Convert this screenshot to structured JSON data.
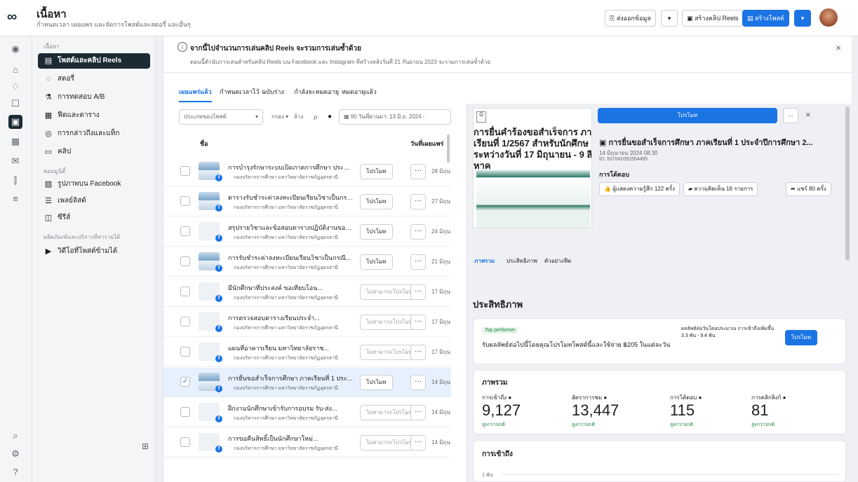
{
  "header": {
    "title": "เนื้อหา",
    "subtitle": "กำหนดเวลา เผยแพร่ และจัดการโพสต์และสตอรี่ และอื่นๆ",
    "buttons": {
      "export": "ส่งออกข้อมูล",
      "create_reel": "สร้างคลิป Reels",
      "create_post": "สร้างโพสต์"
    }
  },
  "nav": {
    "section_content": "เนื้อหา",
    "items": [
      {
        "label": "โพสต์และคลิป Reels",
        "icon": "posts-icon"
      },
      {
        "label": "สตอรี่",
        "icon": "story-icon"
      },
      {
        "label": "การทดสอบ A/B",
        "icon": "ab-test-icon"
      },
      {
        "label": "ฟีดและตาราง",
        "icon": "feed-grid-icon"
      },
      {
        "label": "การกล่าวถึงและแท็ก",
        "icon": "mention-icon"
      },
      {
        "label": "คลิป",
        "icon": "clip-icon"
      }
    ],
    "section_community": "คอมมูนิตี้",
    "items2": [
      {
        "label": "รูปภาพบน Facebook",
        "icon": "image-icon"
      },
      {
        "label": "เพลย์ลิสต์",
        "icon": "playlist-icon"
      },
      {
        "label": "ซีรีส์",
        "icon": "series-icon"
      }
    ],
    "section_monetize": "ผลิตภัณฑ์และบริการที่หารายได้",
    "items3": [
      {
        "label": "วิดีโอที่โพสต์ข้ามได้",
        "icon": "video-icon"
      }
    ]
  },
  "banner": {
    "title": "จากนี้ไปจำนวนการเล่นคลิป Reels จะรวมการเล่นซ้ำด้วย",
    "body": "ตอนนี้ตัวนับการเล่นสำหรับคลิป Reels บน Facebook และ Instagram ที่สร้างหลังวันที่ 21 กันยายน 2023 จะรวมการเล่นซ้ำด้วย"
  },
  "tabs": [
    "เผยแพร่แล้ว",
    "กำหนดเวลาไว้",
    "ฉบับร่าง",
    "กำลังจะหมดอายุ",
    "หมดอายุแล้ว"
  ],
  "filters": {
    "type": "ประเภทของโพสต์",
    "more": "กรอง",
    "clear": "ล้าง",
    "date_range": "90 วันที่ผ่านมา: 13 มิ.ย. 2024 -"
  },
  "columns": {
    "title": "ชื่อ",
    "date": "วันที่เผยแพร่"
  },
  "rows": [
    {
      "title": "การบำรุงรักษาระบบเปิดภาคการศึกษา ประจำภาคเรียน...",
      "sub": "กองบริหารการศึกษา มหาวิทยาลัยราชภัฏอุดรธานี",
      "boost": "โปรโมท",
      "date": "28 มิถุนายน",
      "thumb": true,
      "selected": false
    },
    {
      "title": "ตารางรับชำระค่าลงทะเบียนเรียนวิชาเป็นกรณี...",
      "sub": "กองบริหารการศึกษา มหาวิทยาลัยราชภัฏอุดรธานี",
      "boost": "โปรโมท",
      "date": "27 มิถุนายน",
      "thumb": true,
      "selected": false
    },
    {
      "title": "สรุปรายวิชาและข้อสอบตารางปฏิบัติงานของแต่ละ...",
      "sub": "กองบริหารการศึกษา มหาวิทยาลัยราชภัฏอุดรธานี",
      "boost": "โปรโมท",
      "date": "24 มิถุนายน",
      "thumb": false,
      "selected": false
    },
    {
      "title": "การรับชำระค่าลงทะเบียนเรียนวิชาเป็นกรณี...",
      "sub": "กองบริหารการศึกษา มหาวิทยาลัยราชภัฏอุดรธานี",
      "boost": "โปรโมท",
      "date": "21 มิถุนายน",
      "thumb": true,
      "selected": false
    },
    {
      "title": "มีนักศึกษาที่ประสงค์ ขอเทียบโอน...",
      "sub": "กองบริหารการศึกษา มหาวิทยาลัยราชภัฏอุดรธานี",
      "boost": "ไม่สามารถโปรโมทได้",
      "date": "17 มิถุนายน",
      "thumb": false,
      "selected": false
    },
    {
      "title": "การตรวจสอบตารางเรียนประจำ...",
      "sub": "กองบริหารการศึกษา มหาวิทยาลัยราชภัฏอุดรธานี",
      "boost": "ไม่สามารถโปรโมทได้",
      "date": "17 มิถุนายน",
      "thumb": false,
      "selected": false
    },
    {
      "title": "แผนที่อาคารเรียน มหาวิทยาลัยราช...",
      "sub": "กองบริหารการศึกษา มหาวิทยาลัยราชภัฏอุดรธานี",
      "boost": "ไม่สามารถโปรโมทได้",
      "date": "17 มิถุนายน",
      "thumb": false,
      "selected": false
    },
    {
      "title": "การยื่นขอสำเร็จการศึกษา ภาคเรียนที่ 1 ประ...",
      "sub": "กองบริหารการศึกษา มหาวิทยาลัยราชภัฏอุดรธานี",
      "boost": "โปรโมท",
      "date": "14 มิถุนายน",
      "thumb": true,
      "selected": true
    },
    {
      "title": "ฝึกงานนักศึกษาเข้ารับการอบรม รับ-ส่ง...",
      "sub": "กองบริหารการศึกษา มหาวิทยาลัยราชภัฏอุดรธานี",
      "boost": "ไม่สามารถโปรโมทได้",
      "date": "14 มิถุนายน",
      "thumb": false,
      "selected": false
    },
    {
      "title": "การขอคืนสิทธิ์เป็นนักศึกษาใหม่...",
      "sub": "กองบริหารการศึกษา มหาวิทยาลัยราชภัฏอุดรธานี",
      "boost": "ไม่สามารถโปรโมทได้",
      "date": "14 มิถุนายน",
      "thumb": false,
      "selected": false
    }
  ],
  "detail": {
    "preview_title": "การยื่นคำร้องขอสำเร็จการ ภาคเรียนที่ 1/2567 สำหรับนักศึกษ ระหว่างวันที่ 17 มิถุนายน - 9 สิงหาค",
    "boost_label": "โปรโมท",
    "post_title": "การยื่นขอสำเร็จการศึกษา ภาคเรียนที่ 1 ประจำปีการศึกษา 2...",
    "post_date": "14 มิถุนายน 2024 08:30",
    "post_id": "ID: 937041091554495",
    "reach_label": "การโต้ตอบ",
    "stats": {
      "reactions": "ผู้แสดงความรู้สึก 122 ครั้ง",
      "comments": "ความคิดเห็น 16 รายการ",
      "shares": "แชร์ 80 ครั้ง"
    },
    "tabs": [
      "ภาพรวม",
      "ประสิทธิภาพ",
      "ตัวอย่างฟีด"
    ],
    "performance_title": "ประสิทธิภาพ",
    "top_card": {
      "badge": "Top performer",
      "text": "รับผลลัพธ์ต่อไปนี้โดยคุณโปรโมทโพสต์นี้และใช้จ่าย ฿205 ในแต่ละวัน",
      "estimate": "ผลลัพธ์ต่อวันโดยประมาณ การเข้าถึงเพิ่มขึ้น 3.3 พัน - 9.4 พัน",
      "button": "โปรโมท"
    },
    "overview": {
      "title": "ภาพรวม",
      "metrics": [
        {
          "label": "การเข้าถึง",
          "value": "9,127",
          "sub": "สูงกว่าปกติ"
        },
        {
          "label": "อัตราการชม",
          "value": "13,447",
          "sub": "สูงกว่าปกติ"
        },
        {
          "label": "การโต้ตอบ",
          "value": "115",
          "sub": "สูงกว่าปกติ"
        },
        {
          "label": "การคลิกลิงก์",
          "value": "81",
          "sub": "สูงกว่าปกติ"
        }
      ]
    },
    "reach_card": {
      "title": "การเข้าถึง",
      "axis_top": "1 พัน"
    }
  },
  "colors": {
    "accent": "#1b74e4",
    "dark": "#1c2b33"
  }
}
